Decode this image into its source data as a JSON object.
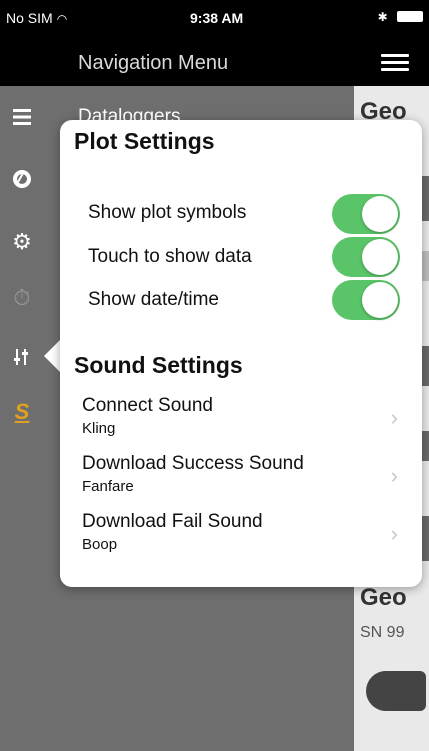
{
  "status_bar": {
    "carrier": "No SIM",
    "time": "9:38 AM",
    "bluetooth": "✱"
  },
  "nav": {
    "title": "Navigation Menu"
  },
  "side_menu": {
    "first_item_label": "Dataloggers",
    "icons": [
      "list-icon",
      "brand-circle-icon",
      "gear-icon",
      "timer-icon",
      "sliders-icon",
      "s-logo-icon"
    ]
  },
  "content_peek": {
    "title1": "Geo",
    "title2": "Geo",
    "sub2": "SN 99"
  },
  "plot_settings": {
    "title": "Plot Settings",
    "rows": [
      {
        "label": "Show plot symbols",
        "on": true
      },
      {
        "label": "Touch to show data",
        "on": true
      },
      {
        "label": "Show date/time",
        "on": true
      }
    ]
  },
  "sound_settings": {
    "title": "Sound Settings",
    "rows": [
      {
        "title": "Connect Sound",
        "value": "Kling"
      },
      {
        "title": "Download Success Sound",
        "value": "Fanfare"
      },
      {
        "title": "Download Fail Sound",
        "value": "Boop"
      }
    ]
  },
  "colors": {
    "toggle_on": "#5ac468",
    "accent_s": "#e0a020"
  }
}
